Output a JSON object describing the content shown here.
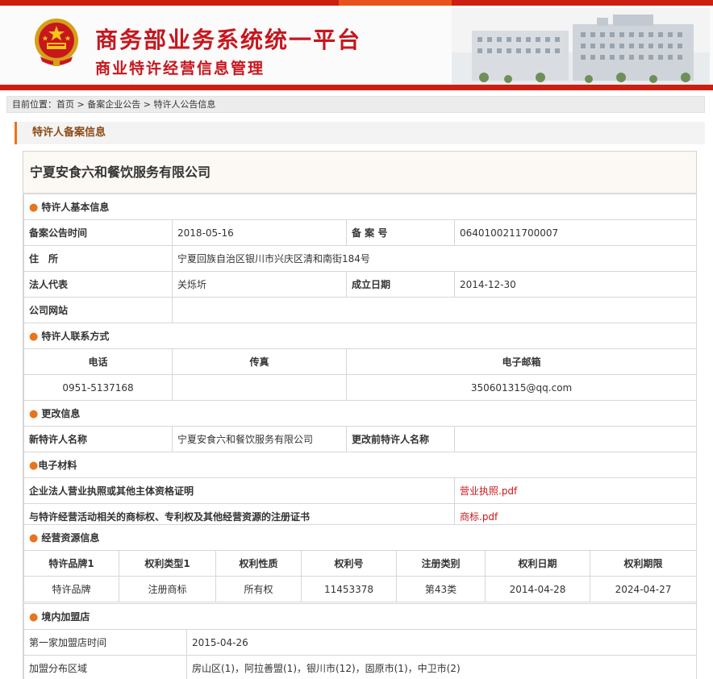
{
  "header": {
    "title_main": "商务部业务系统统一平台",
    "title_sub": "商业特许经营信息管理"
  },
  "breadcrumb": {
    "prefix": "目前位置：",
    "home": "首页",
    "sep1": " > ",
    "level1": "备案企业公告",
    "sep2": " > ",
    "level2": "特许人公告信息"
  },
  "section_title": "特许人备案信息",
  "company_name": "宁夏安食六和餐饮服务有限公司",
  "basic": {
    "heading": "特许人基本信息",
    "filing_date_label": "备案公告时间",
    "filing_date": "2018-05-16",
    "record_no_label": "备 案 号",
    "record_no": "0640100211700007",
    "address_label": "住　所",
    "address": "宁夏回族自治区银川市兴庆区清和南街184号",
    "legal_rep_label": "法人代表",
    "legal_rep": "关烁圻",
    "established_label": "成立日期",
    "established": "2014-12-30",
    "website_label": "公司网站",
    "website": ""
  },
  "contact": {
    "heading": "特许人联系方式",
    "phone_label": "电话",
    "fax_label": "传真",
    "email_label": "电子邮箱",
    "phone": "0951-5137168",
    "fax": "",
    "email": "350601315@qq.com"
  },
  "change": {
    "heading": "更改信息",
    "new_name_label": "新特许人名称",
    "new_name": "宁夏安食六和餐饮服务有限公司",
    "old_name_label": "更改前特许人名称",
    "old_name": ""
  },
  "materials": {
    "heading": "电子材料",
    "license_label": "企业法人营业执照或其他主体资格证明",
    "license_file": "营业执照.pdf",
    "trademark_label": "与特许经营活动相关的商标权、专利权及其他经营资源的注册证书",
    "trademark_file": "商标.pdf"
  },
  "resources": {
    "heading": "经营资源信息",
    "columns": [
      "特许品牌1",
      "权利类型1",
      "权利性质",
      "权利号",
      "注册类别",
      "权利日期",
      "权利期限"
    ],
    "rows": [
      [
        "特许品牌",
        "注册商标",
        "所有权",
        "11453378",
        "第43类",
        "2014-04-28",
        "2024-04-27"
      ]
    ]
  },
  "stores": {
    "heading": "境内加盟店",
    "first_store_label": "第一家加盟店时间",
    "first_store_date": "2015-04-26",
    "region_label": "加盟分布区域",
    "regions": "房山区(1)，阿拉善盟(1)，银川市(12)，固原市(1)，中卫市(2)"
  },
  "colors": {
    "brand_red": "#c8161d",
    "accent_orange": "#e8741c",
    "section_text": "#8a4b16"
  }
}
